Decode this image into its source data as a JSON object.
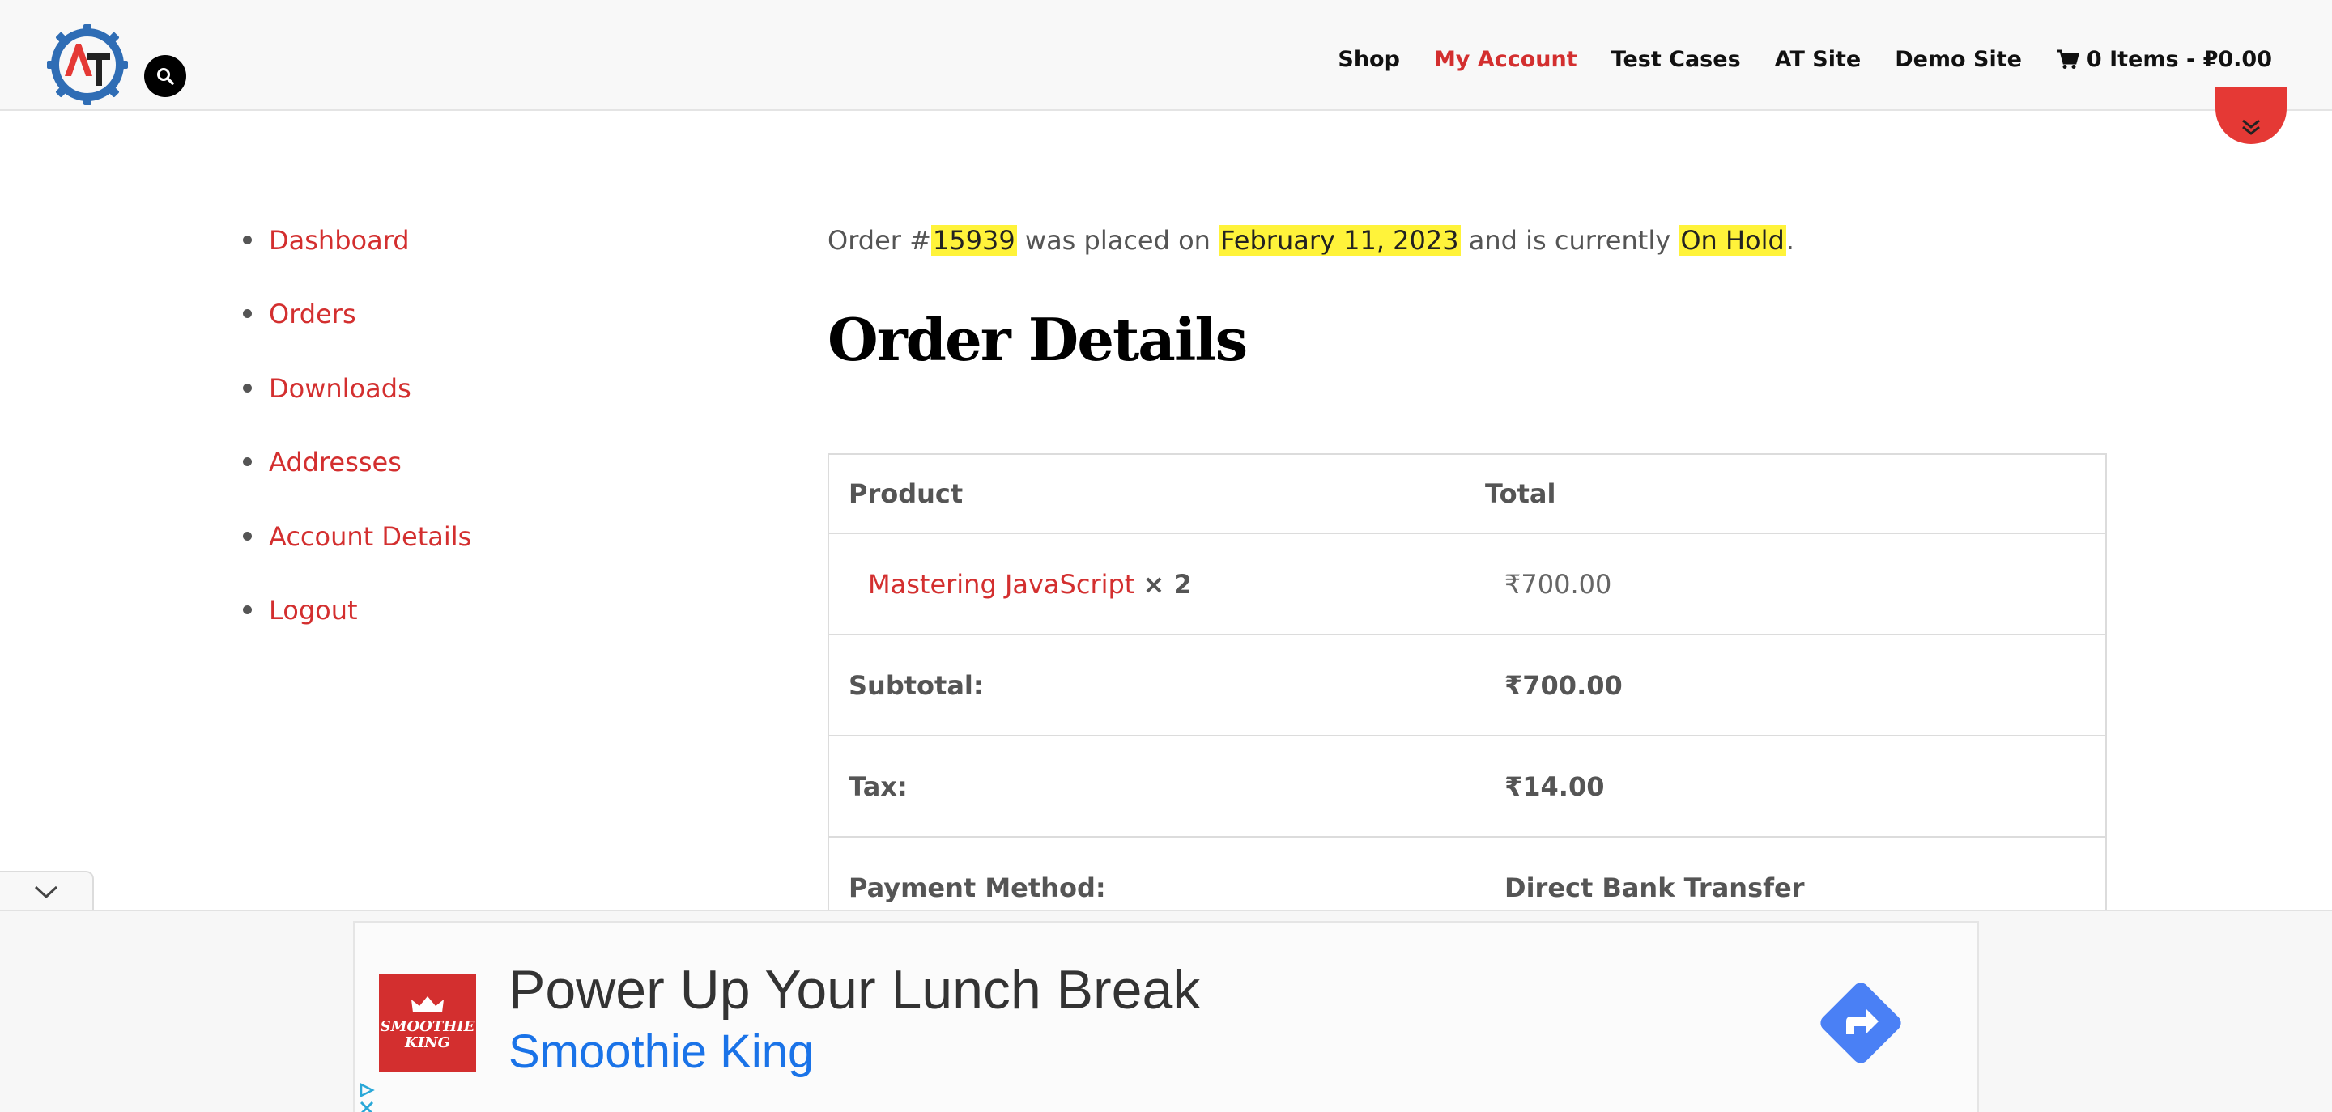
{
  "header": {
    "nav": [
      {
        "label": "Shop"
      },
      {
        "label": "My Account",
        "active": true
      },
      {
        "label": "Test Cases"
      },
      {
        "label": "AT Site"
      },
      {
        "label": "Demo Site"
      }
    ],
    "cart_label": "0 Items - ₽0.00",
    "logo_icon": "automationtesting-gear-logo",
    "search_icon": "search-icon"
  },
  "sidebar": {
    "items": [
      {
        "label": "Dashboard"
      },
      {
        "label": "Orders"
      },
      {
        "label": "Downloads"
      },
      {
        "label": "Addresses"
      },
      {
        "label": "Account Details"
      },
      {
        "label": "Logout"
      }
    ]
  },
  "order": {
    "prefix": "Order #",
    "number": "15939",
    "placed_text": " was placed on ",
    "date": "February 11, 2023",
    "status_text": " and is currently ",
    "status": "On Hold",
    "period": "."
  },
  "details": {
    "title": "Order Details",
    "col_product": "Product",
    "col_total": "Total",
    "item": {
      "name": "Mastering JavaScript",
      "qty": "× 2",
      "total": "₹700.00"
    },
    "rows": [
      {
        "label": "Subtotal:",
        "value": "₹700.00"
      },
      {
        "label": "Tax:",
        "value": "₹14.00"
      },
      {
        "label": "Payment Method:",
        "value": "Direct Bank Transfer"
      }
    ]
  },
  "ad": {
    "logo_line1": "SMOOTHIE",
    "logo_line2": "KING",
    "title": "Power Up Your Lunch Break",
    "subtitle": "Smoothie King"
  },
  "colors": {
    "accent": "#d32f2f",
    "highlight": "#fff33a",
    "ad_link": "#1a73e8",
    "cta": "#4a80f5"
  }
}
